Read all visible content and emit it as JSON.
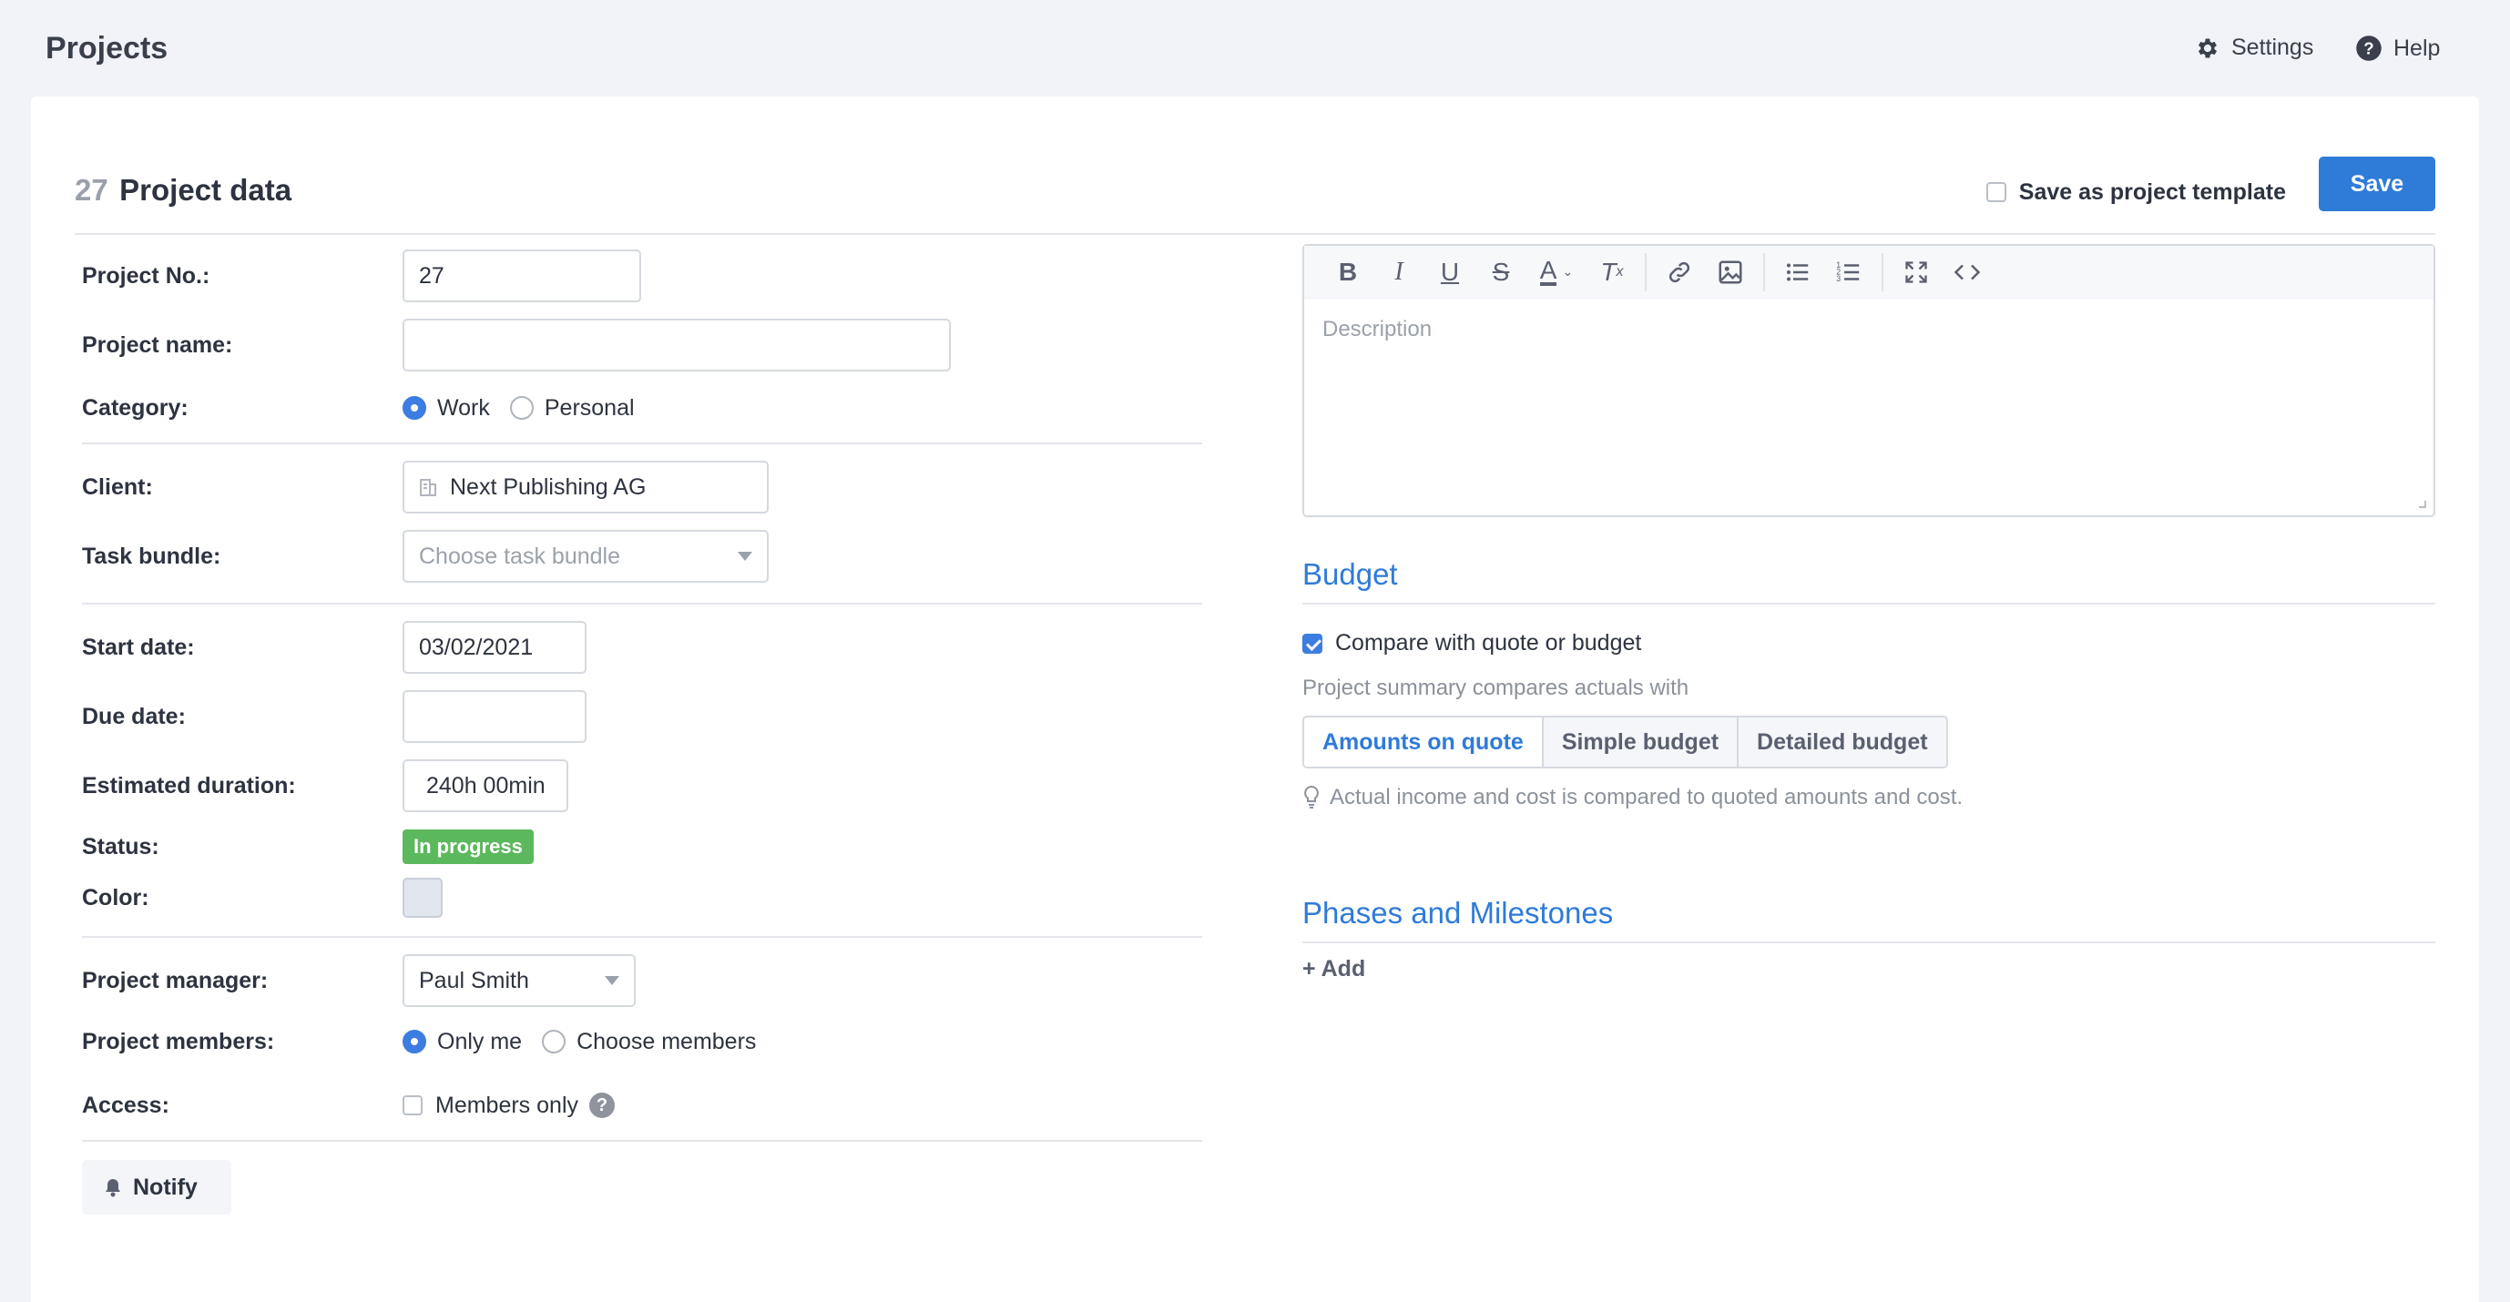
{
  "app": {
    "title": "Projects",
    "settings_label": "Settings",
    "help_label": "Help"
  },
  "header": {
    "project_number": "27",
    "title": "Project data",
    "save_template_label": "Save as project template",
    "save_label": "Save"
  },
  "form": {
    "project_no": {
      "label": "Project No.:",
      "value": "27"
    },
    "project_name": {
      "label": "Project name:",
      "value": ""
    },
    "category": {
      "label": "Category:",
      "options": [
        "Work",
        "Personal"
      ],
      "selected": "Work"
    },
    "client": {
      "label": "Client:",
      "value": "Next Publishing AG"
    },
    "task_bundle": {
      "label": "Task bundle:",
      "placeholder": "Choose task bundle"
    },
    "start_date": {
      "label": "Start date:",
      "value": "03/02/2021"
    },
    "due_date": {
      "label": "Due date:",
      "value": ""
    },
    "estimated_duration": {
      "label": "Estimated duration:",
      "value": "240h 00min"
    },
    "status": {
      "label": "Status:",
      "value": "In progress",
      "color": "#5cb85c"
    },
    "color": {
      "label": "Color:",
      "value": "#e1e6ef"
    },
    "project_manager": {
      "label": "Project manager:",
      "value": "Paul Smith"
    },
    "project_members": {
      "label": "Project members:",
      "options": [
        "Only me",
        "Choose members"
      ],
      "selected": "Only me"
    },
    "access": {
      "label": "Access:",
      "option": "Members only",
      "help": "?"
    },
    "notify_label": "Notify"
  },
  "editor": {
    "placeholder": "Description",
    "tools": [
      "bold-icon",
      "italic-icon",
      "underline-icon",
      "strikethrough-icon",
      "text-color-icon",
      "clear-format-icon",
      "link-icon",
      "image-icon",
      "bullet-list-icon",
      "numbered-list-icon",
      "fullscreen-icon",
      "code-view-icon"
    ]
  },
  "budget": {
    "title": "Budget",
    "compare_label": "Compare with quote or budget",
    "compare_checked": true,
    "summary_text": "Project summary compares actuals with",
    "modes": [
      "Amounts on quote",
      "Simple budget",
      "Detailed budget"
    ],
    "active_mode": "Amounts on quote",
    "hint": "Actual income and cost is compared to quoted amounts and cost."
  },
  "phases": {
    "title": "Phases and Milestones",
    "add_label": "+ Add"
  },
  "colors": {
    "accent": "#2f7bd8",
    "status_green": "#5cb85c"
  }
}
